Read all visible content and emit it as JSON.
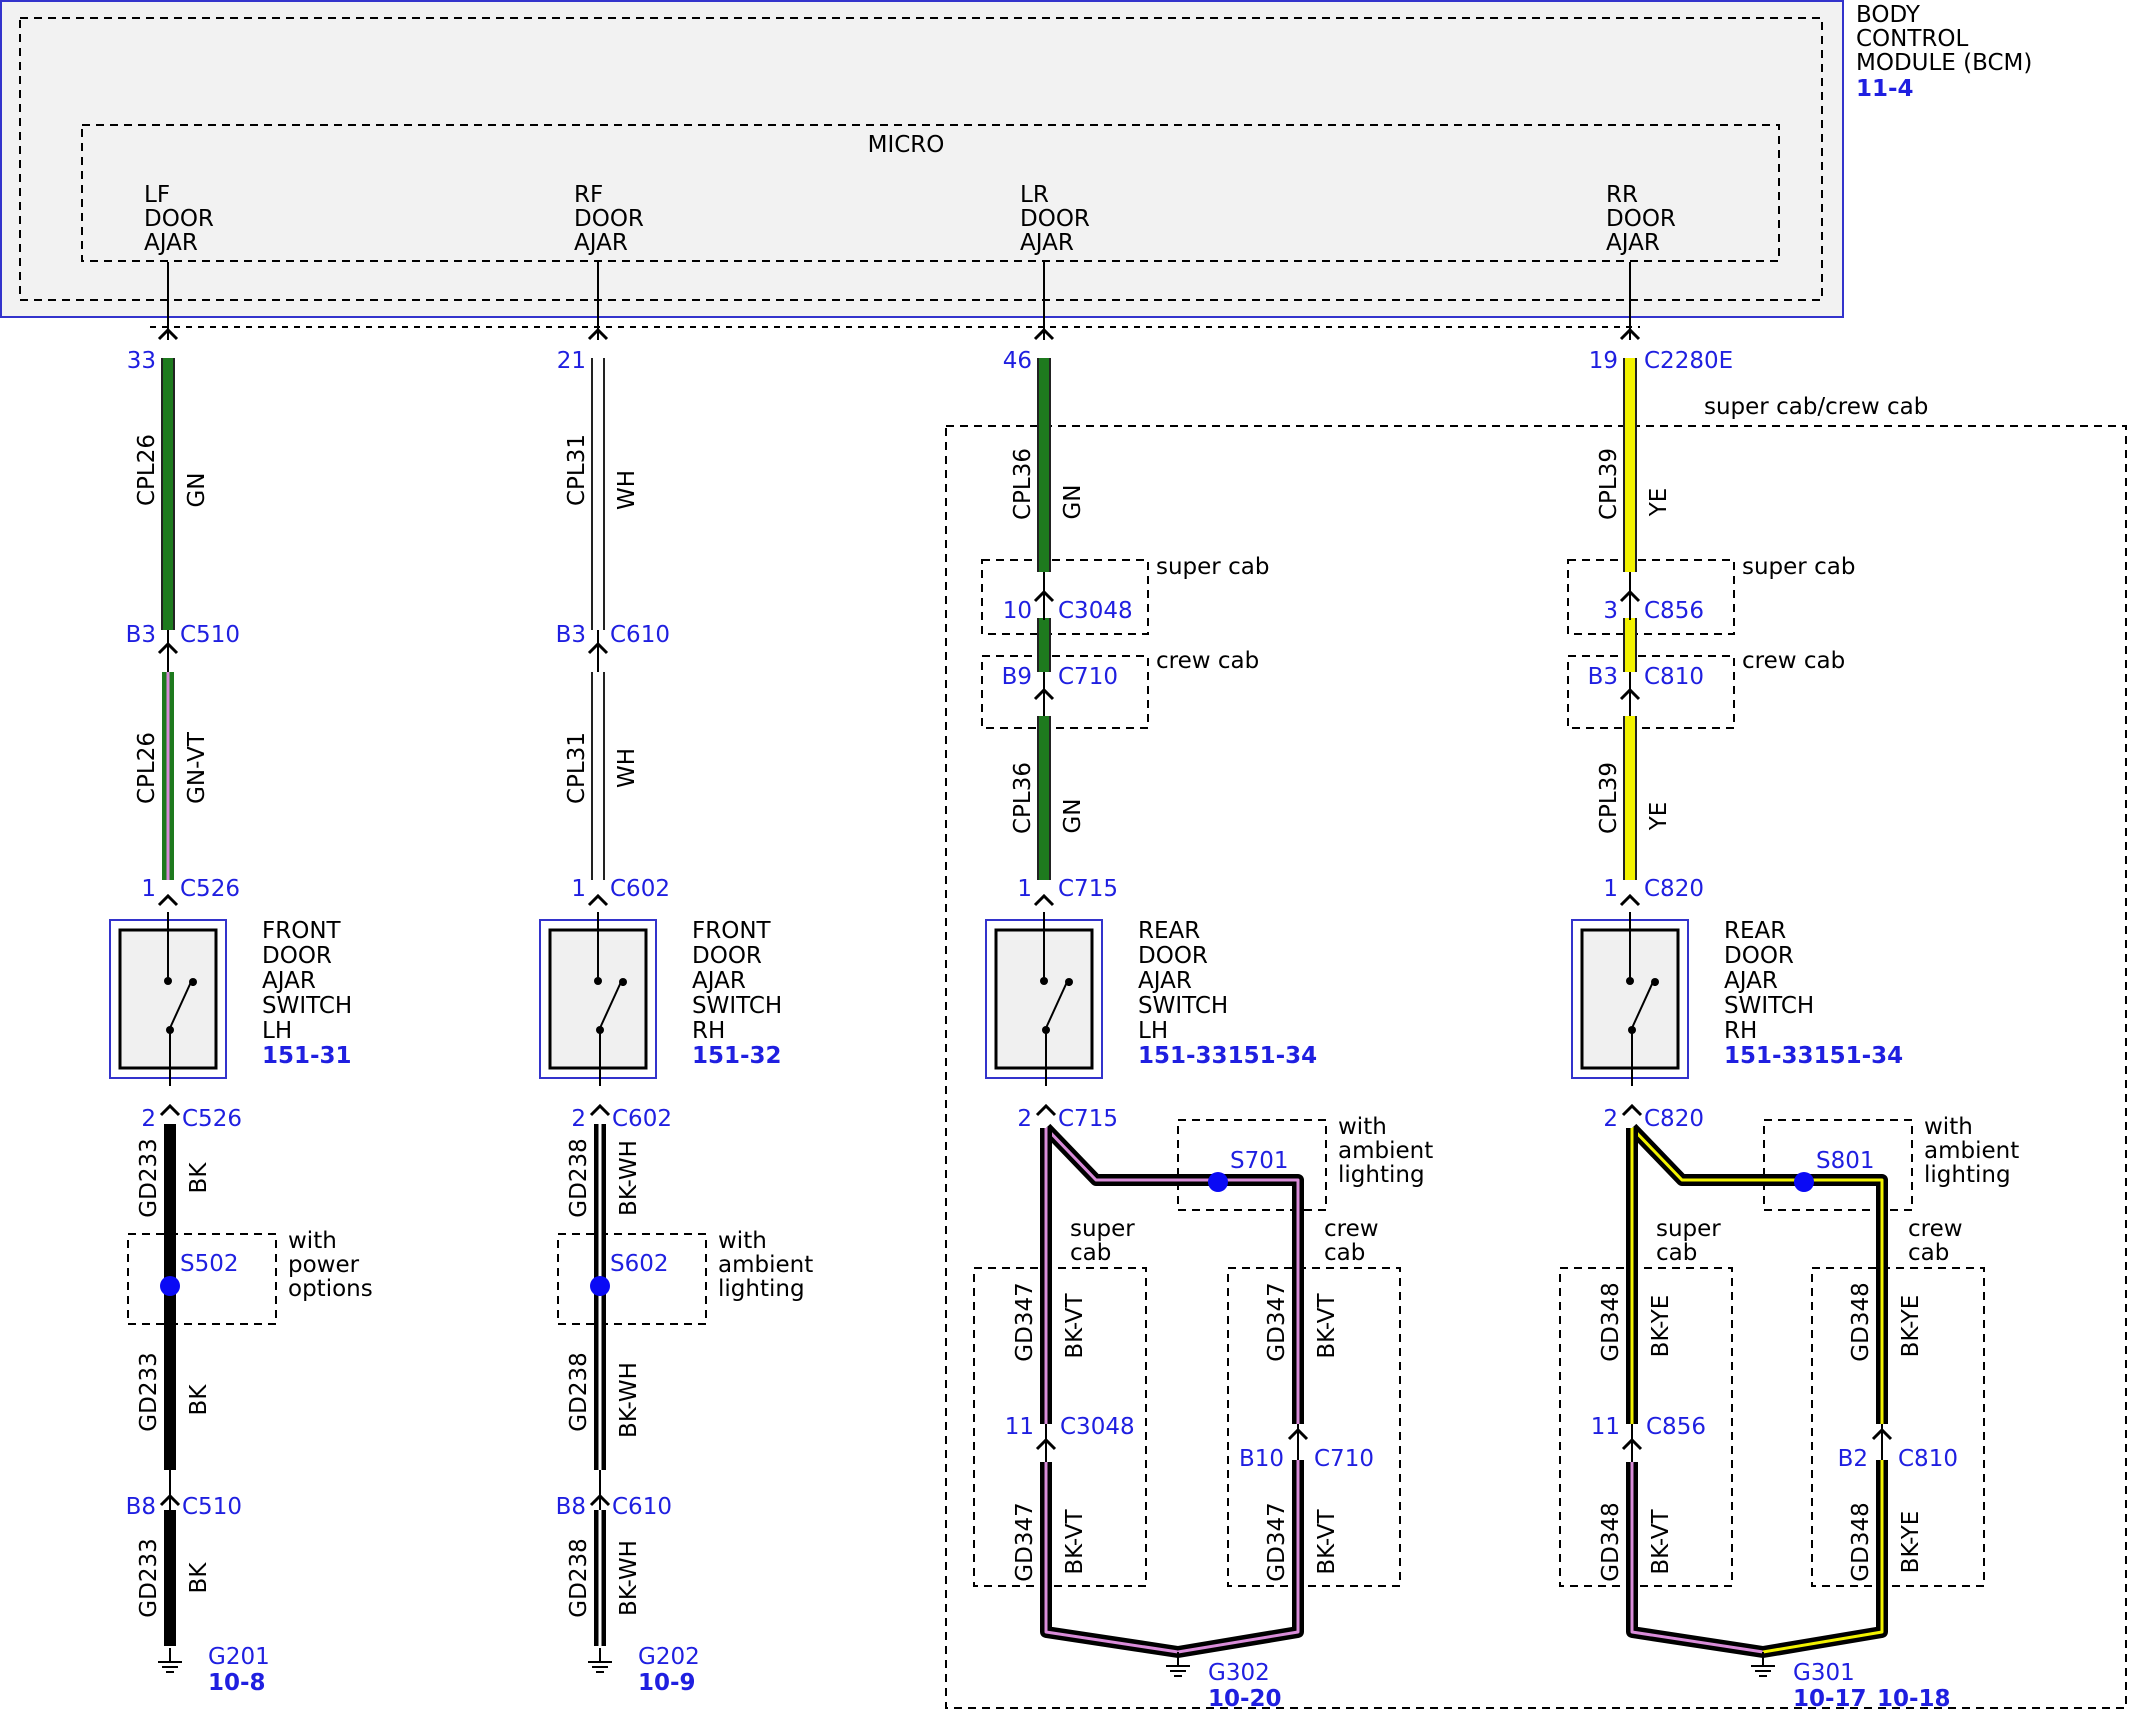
{
  "module": {
    "lines": [
      "BODY",
      "CONTROL",
      "MODULE (BCM)"
    ],
    "ref": "11-4",
    "micro_label": "MICRO",
    "input_labels": [
      [
        "LF",
        "DOOR",
        "AJAR"
      ],
      [
        "RF",
        "DOOR",
        "AJAR"
      ],
      [
        "LR",
        "DOOR",
        "AJAR"
      ],
      [
        "RR",
        "DOOR",
        "AJAR"
      ]
    ]
  },
  "region_label": "super cab/crew cab",
  "colors": {
    "GN": "#1e7a1e",
    "WH": "#ffffff",
    "YE": "#f2f200",
    "BK": "#000000",
    "VT": "#d98cd9",
    "pin_text": "#1f1fe0",
    "bcm_border": "#3333cc",
    "switch_fill": "#f0f0f0"
  },
  "circuits": {
    "lf": {
      "top_pin": "33",
      "top_connector": "",
      "wire1": {
        "circuit": "CPL26",
        "color": "GN"
      },
      "inline1": {
        "pin": "B3",
        "connector": "C510"
      },
      "wire2": {
        "circuit": "CPL26",
        "color": "GN-VT"
      },
      "switch_pin_in": {
        "pin": "1",
        "connector": "C526"
      },
      "switch": {
        "lines": [
          "FRONT",
          "DOOR",
          "AJAR",
          "SWITCH",
          "LH"
        ],
        "ref": "151-31"
      },
      "switch_pin_out": {
        "pin": "2",
        "connector": "C526"
      },
      "ground_wire_a": {
        "circuit": "GD233",
        "color": "BK"
      },
      "splice": {
        "id": "S502",
        "note": [
          "with",
          "power",
          "options"
        ]
      },
      "ground_wire_b": {
        "circuit": "GD233",
        "color": "BK"
      },
      "inline2": {
        "pin": "B8",
        "connector": "C510"
      },
      "ground_wire_c": {
        "circuit": "GD233",
        "color": "BK"
      },
      "ground": {
        "id": "G201",
        "ref": "10-8"
      }
    },
    "rf": {
      "top_pin": "21",
      "top_connector": "",
      "wire1": {
        "circuit": "CPL31",
        "color": "WH"
      },
      "inline1": {
        "pin": "B3",
        "connector": "C610"
      },
      "wire2": {
        "circuit": "CPL31",
        "color": "WH"
      },
      "switch_pin_in": {
        "pin": "1",
        "connector": "C602"
      },
      "switch": {
        "lines": [
          "FRONT",
          "DOOR",
          "AJAR",
          "SWITCH",
          "RH"
        ],
        "ref": "151-32"
      },
      "switch_pin_out": {
        "pin": "2",
        "connector": "C602"
      },
      "ground_wire_a": {
        "circuit": "GD238",
        "color": "BK-WH"
      },
      "splice": {
        "id": "S602",
        "note": [
          "with",
          "ambient",
          "lighting"
        ]
      },
      "ground_wire_b": {
        "circuit": "GD238",
        "color": "BK-WH"
      },
      "inline2": {
        "pin": "B8",
        "connector": "C610"
      },
      "ground_wire_c": {
        "circuit": "GD238",
        "color": "BK-WH"
      },
      "ground": {
        "id": "G202",
        "ref": "10-9"
      }
    },
    "lr": {
      "top_pin": "46",
      "top_connector": "",
      "wire1": {
        "circuit": "CPL36",
        "color": "GN"
      },
      "super_cab": {
        "label": "super cab",
        "pin": "10",
        "connector": "C3048"
      },
      "crew_cab": {
        "label": "crew cab",
        "pin": "B9",
        "connector": "C710"
      },
      "wire2": {
        "circuit": "CPL36",
        "color": "GN"
      },
      "switch_pin_in": {
        "pin": "1",
        "connector": "C715"
      },
      "switch": {
        "lines": [
          "REAR",
          "DOOR",
          "AJAR",
          "SWITCH",
          "LH"
        ],
        "ref": "151-33151-34"
      },
      "switch_pin_out": {
        "pin": "2",
        "connector": "C715"
      },
      "splice": {
        "id": "S701",
        "note": [
          "with",
          "ambient",
          "lighting"
        ]
      },
      "super_branch": {
        "label": [
          "super",
          "cab"
        ],
        "wire_a": {
          "circuit": "GD347",
          "color": "BK-VT"
        },
        "inline": {
          "pin": "11",
          "connector": "C3048"
        },
        "wire_b": {
          "circuit": "GD347",
          "color": "BK-VT"
        }
      },
      "crew_branch": {
        "label": [
          "crew",
          "cab"
        ],
        "wire_a": {
          "circuit": "GD347",
          "color": "BK-VT"
        },
        "inline": {
          "pin": "B10",
          "connector": "C710"
        },
        "wire_b": {
          "circuit": "GD347",
          "color": "BK-VT"
        }
      },
      "ground": {
        "id": "G302",
        "ref": "10-20"
      }
    },
    "rr": {
      "top_pin": "19",
      "top_connector": "C2280E",
      "wire1": {
        "circuit": "CPL39",
        "color": "YE"
      },
      "super_cab": {
        "label": "super cab",
        "pin": "3",
        "connector": "C856"
      },
      "crew_cab": {
        "label": "crew cab",
        "pin": "B3",
        "connector": "C810"
      },
      "wire2": {
        "circuit": "CPL39",
        "color": "YE"
      },
      "switch_pin_in": {
        "pin": "1",
        "connector": "C820"
      },
      "switch": {
        "lines": [
          "REAR",
          "DOOR",
          "AJAR",
          "SWITCH",
          "RH"
        ],
        "ref": "151-33151-34"
      },
      "switch_pin_out": {
        "pin": "2",
        "connector": "C820"
      },
      "splice": {
        "id": "S801",
        "note": [
          "with",
          "ambient",
          "lighting"
        ]
      },
      "super_branch": {
        "label": [
          "super",
          "cab"
        ],
        "wire_a": {
          "circuit": "GD348",
          "color": "BK-YE"
        },
        "inline": {
          "pin": "11",
          "connector": "C856"
        },
        "wire_b": {
          "circuit": "GD348",
          "color": "BK-VT"
        }
      },
      "crew_branch": {
        "label": [
          "crew",
          "cab"
        ],
        "wire_a": {
          "circuit": "GD348",
          "color": "BK-YE"
        },
        "inline": {
          "pin": "B2",
          "connector": "C810"
        },
        "wire_b": {
          "circuit": "GD348",
          "color": "BK-YE"
        }
      },
      "ground": {
        "id": "G301",
        "ref": "10-17",
        "ref2": "10-18"
      }
    }
  }
}
